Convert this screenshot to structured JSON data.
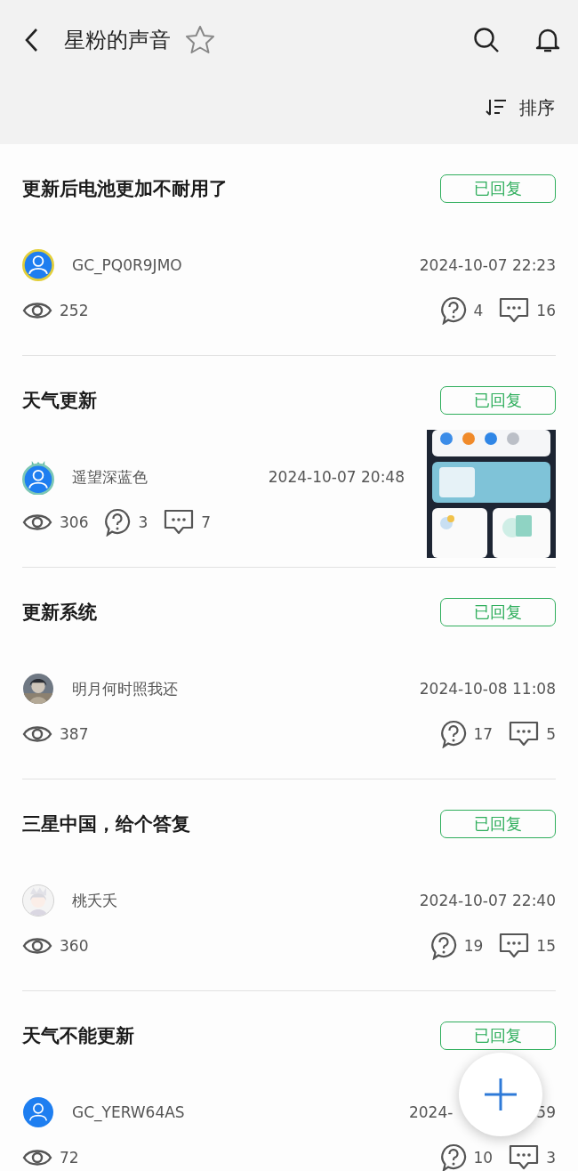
{
  "header": {
    "title": "星粉的声音",
    "favorited": false
  },
  "sort": {
    "label": "排序"
  },
  "posts": [
    {
      "kind": "plain",
      "title": "更新后电池更加不耐用了",
      "status": "已回复",
      "avatar": {
        "kind": "ring"
      },
      "user": "GC_PQ0R9JMO",
      "time": "2024-10-07 22:23",
      "views": "252",
      "questions": "4",
      "comments": "16"
    },
    {
      "title": "天气更新",
      "status": "已回复",
      "avatar": {
        "kind": "crown"
      },
      "user": "遥望深蓝色",
      "time": "2024-10-07 20:48",
      "views": "306",
      "questions": "3",
      "comments": "7"
    },
    {
      "kind": "plain",
      "title": "更新系统",
      "status": "已回复",
      "avatar": {
        "kind": "dark-picture"
      },
      "user": "明月何时照我还",
      "time": "2024-10-08 11:08",
      "views": "387",
      "questions": "17",
      "comments": "5"
    },
    {
      "kind": "plain",
      "title": "三星中国，给个答复",
      "status": "已回复",
      "avatar": {
        "kind": "light-picture"
      },
      "user": "桃夭夭",
      "time": "2024-10-07 22:40",
      "views": "360",
      "questions": "19",
      "comments": "15"
    },
    {
      "kind": "plain",
      "title": "天气不能更新",
      "status": "已回复",
      "avatar": {
        "kind": "plain"
      },
      "user": "GC_YERW64AS",
      "time_parts": [
        "2024-",
        "59"
      ],
      "views": "72",
      "questions": "10",
      "comments": "3"
    }
  ]
}
